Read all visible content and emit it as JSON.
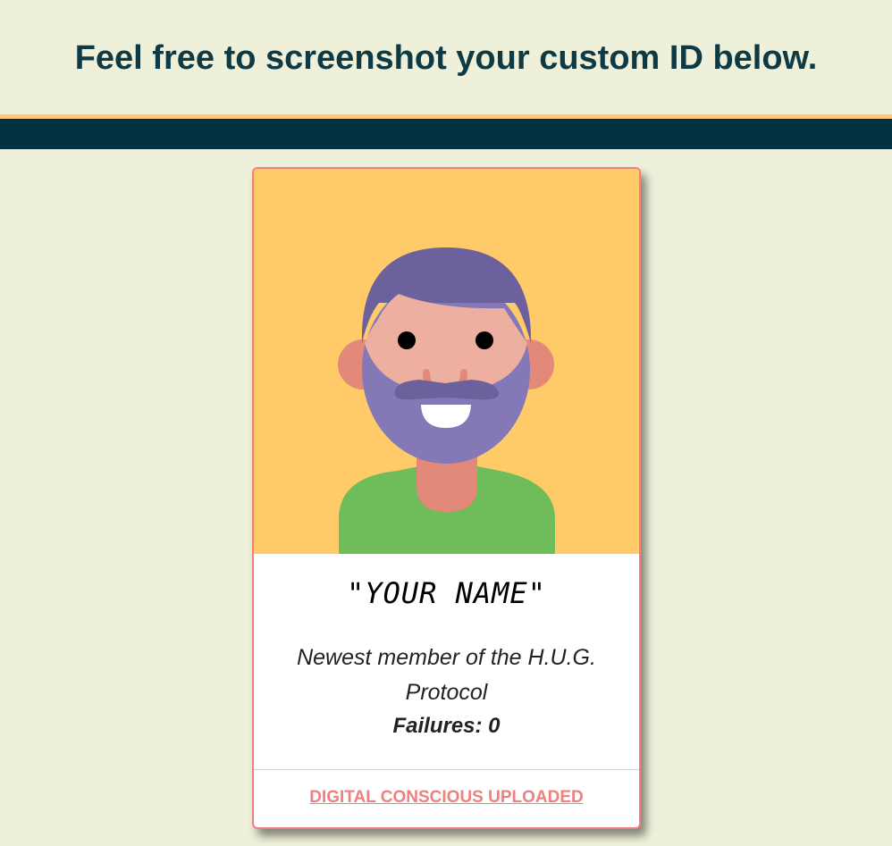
{
  "header": {
    "title": "Feel free to screenshot your custom ID below."
  },
  "card": {
    "name": "\"YOUR NAME\"",
    "description": "Newest member of the H.U.G. Protocol",
    "failures_text": "Failures: 0",
    "link_text": "DIGITAL CONSCIOUS UPLOADED",
    "avatar_icon": "bearded-man-avatar-icon"
  },
  "colors": {
    "page_bg": "#eff0da",
    "title_text": "#0d3a44",
    "accent_stripe": "#fbc88a",
    "nav_bar": "#02313f",
    "card_border": "#f08080",
    "avatar_bg": "#ffcb69",
    "link": "#f08080"
  }
}
